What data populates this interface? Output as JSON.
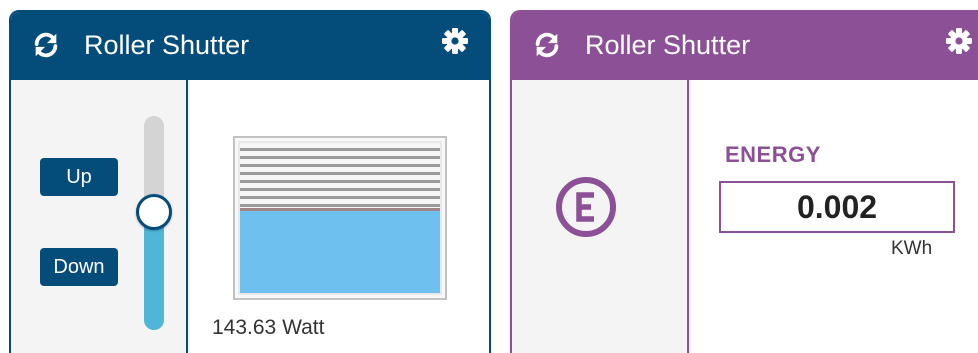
{
  "colors": {
    "blue_accent": "#044c7a",
    "purple_accent": "#8c5096",
    "slider_fill": "#4fb6d8",
    "shutter_glass": "#6ec0ee",
    "panel_bg": "#f4f4f4"
  },
  "shutter_card": {
    "title": "Roller Shutter",
    "refresh_icon": "refresh-icon",
    "settings_icon": "gear-icon",
    "up_label": "Up",
    "down_label": "Down",
    "position_fraction": 0.45,
    "power_readout": "143.63 Watt"
  },
  "energy_card": {
    "title": "Roller Shutter",
    "refresh_icon": "refresh-icon",
    "settings_icon": "gear-icon",
    "badge_icon": "energy-e-icon",
    "label": "ENERGY",
    "value": "0.002",
    "unit": "KWh"
  }
}
